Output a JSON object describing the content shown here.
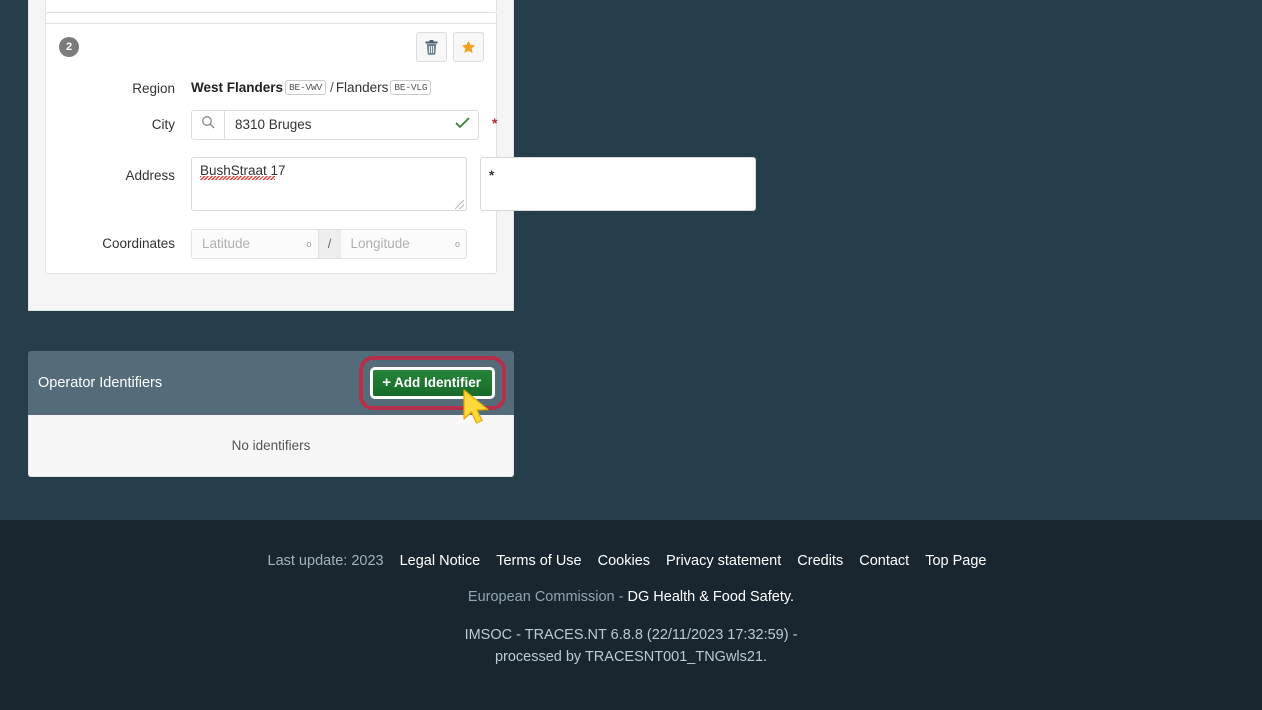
{
  "address_block": {
    "sequence_badge": "2",
    "actions": {
      "delete_label": "trash-icon",
      "favourite_label": "star-icon"
    },
    "fields": {
      "region": {
        "label": "Region",
        "value_primary": "West Flanders",
        "code_primary": "BE-VWV",
        "separator": "/",
        "value_secondary": "Flanders",
        "code_secondary": "BE-VLG"
      },
      "city": {
        "label": "City",
        "value": "8310 Bruges",
        "search_icon": "search-icon",
        "valid_icon": "check-icon",
        "required_marker": "*"
      },
      "address": {
        "label": "Address",
        "value": "BushStraat 17",
        "required_marker": "*"
      },
      "coordinates": {
        "label": "Coordinates",
        "latitude_placeholder": "Latitude",
        "longitude_placeholder": "Longitude",
        "degree_symbol": "o",
        "separator": "/"
      }
    }
  },
  "operator_identifiers": {
    "title": "Operator Identifiers",
    "add_button_label": "Add Identifier",
    "add_button_plus": "+",
    "empty_message": "No identifiers",
    "header_color": "#546c7a",
    "button_color": "#1d7a2e",
    "highlight_color": "#b5304a"
  },
  "footer": {
    "last_update": "Last update: 2023",
    "links": [
      "Legal Notice",
      "Terms of Use",
      "Cookies",
      "Privacy statement",
      "Credits",
      "Contact",
      "Top Page"
    ],
    "org_prefix": "European Commission - ",
    "org_name": "DG Health & Food Safety.",
    "version_line": "IMSOC - TRACES.NT 6.8.8 (22/11/2023 17:32:59) -",
    "processed_line": "processed by TRACESNT001_TNGwls21."
  },
  "theme": {
    "page_background": "#263d4c",
    "footer_background": "#19262f"
  }
}
